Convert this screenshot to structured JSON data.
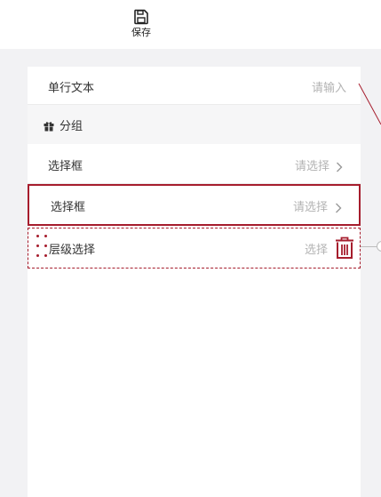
{
  "toolbar": {
    "save_label": "保存",
    "save_icon": "save-icon"
  },
  "fields": {
    "single_text": {
      "label": "单行文本",
      "placeholder": "请输入"
    },
    "group": {
      "label": "分组",
      "icon": "gift-icon"
    },
    "select_1": {
      "label": "选择框",
      "placeholder": "请选择"
    },
    "select_2": {
      "label": "选择框",
      "placeholder": "请选择",
      "selected": true
    },
    "level_select": {
      "label": "层级选择",
      "placeholder": "选择",
      "dragging": true
    }
  },
  "colors": {
    "accent": "#a61d2d",
    "background": "#f2f2f4",
    "surface": "#ffffff",
    "placeholder": "#b3b3b3"
  }
}
